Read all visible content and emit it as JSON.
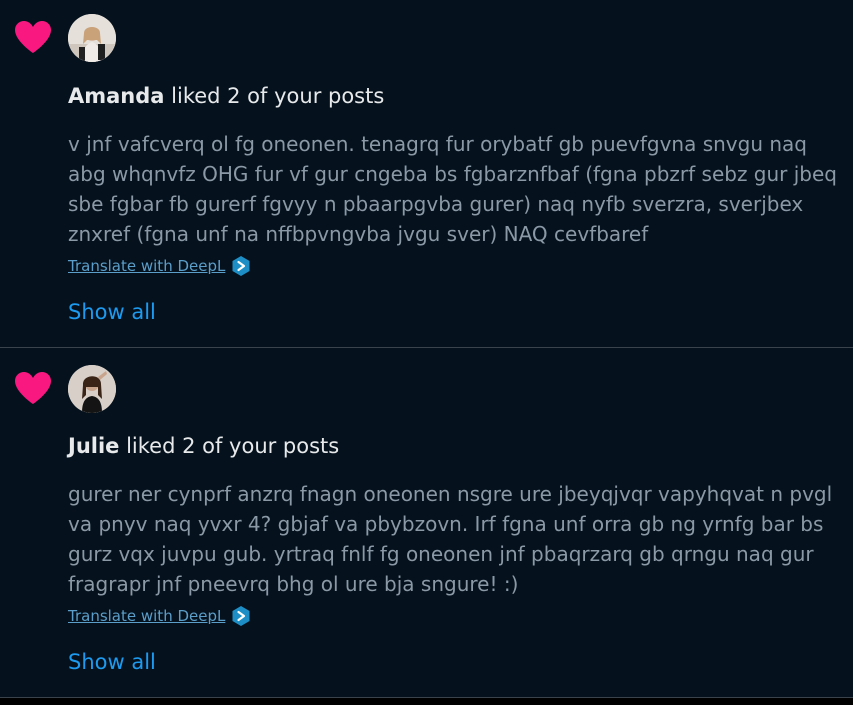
{
  "colors": {
    "background": "#05121e",
    "heart": "#f91880",
    "link": "#1d9bf0",
    "muted_text": "#8b98a5",
    "primary_text": "#e7e9ea",
    "divider": "#3a424b"
  },
  "notifications": [
    {
      "icon": "heart-icon",
      "user_name": "Amanda",
      "action_text": " liked 2 of your posts",
      "post_text": "v jnf vafcverq ol fg oneonen. tenagrq fur orybatf gb puevfgvna snvgu naq abg whqnvfz OHG fur vf gur cngeba bs fgbarznfbaf (fgna pbzrf sebz gur jbeq sbe fgbar fb gurerf fgvyy n pbaarpgvba gurer) naq nyfb sverzra, sverjbex znxref (fgna unf na nffbpvngvba jvgu sver) NAQ cevfbaref",
      "translate_label": "Translate with DeepL",
      "show_all_label": "Show all"
    },
    {
      "icon": "heart-icon",
      "user_name": "Julie",
      "action_text": " liked 2 of your posts",
      "post_text": "gurer ner cynprf anzrq fnagn oneonen nsgre ure jbeyqjvqr vapyhqvat n pvgl va pnyv naq yvxr 4? gbjaf va pbybzovn. Irf fgna unf orra gb ng yrnfg bar bs gurz vqx juvpu gub. yrtraq fnlf fg oneonen jnf pbaqrzarq gb qrngu naq gur fragrapr jnf pneevrq bhg ol ure bja sngure! :)",
      "translate_label": "Translate with DeepL",
      "show_all_label": "Show all"
    }
  ]
}
